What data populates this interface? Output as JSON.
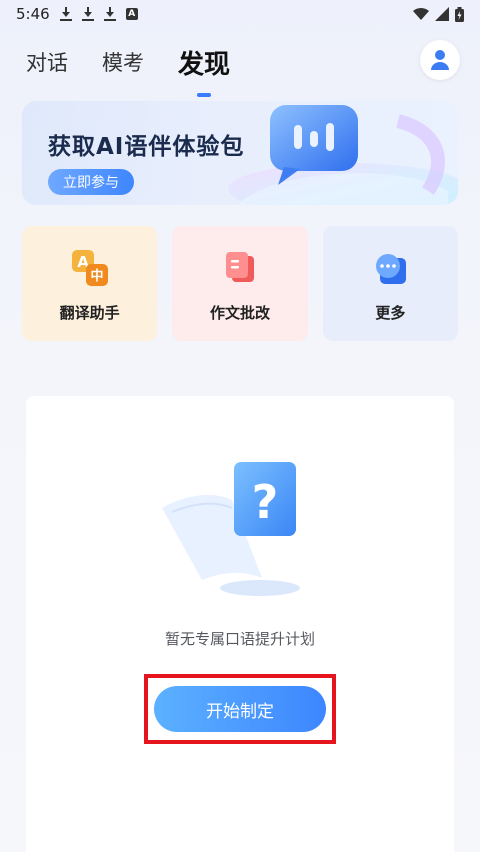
{
  "status_bar": {
    "time": "5:46",
    "badge_letter": "A"
  },
  "tabs": [
    {
      "label": "对话",
      "active": false
    },
    {
      "label": "模考",
      "active": false
    },
    {
      "label": "发现",
      "active": true
    }
  ],
  "banner": {
    "title": "获取AI语伴体验包",
    "button_label": "立即参与"
  },
  "tools": [
    {
      "label": "翻译助手",
      "icon": "translate-icon"
    },
    {
      "label": "作文批改",
      "icon": "essay-correction-icon"
    },
    {
      "label": "更多",
      "icon": "more-icon"
    }
  ],
  "plan": {
    "empty_text": "暂无专属口语提升计划",
    "button_label": "开始制定"
  },
  "colors": {
    "accent": "#3a7bff",
    "highlight": "#e6141c"
  }
}
